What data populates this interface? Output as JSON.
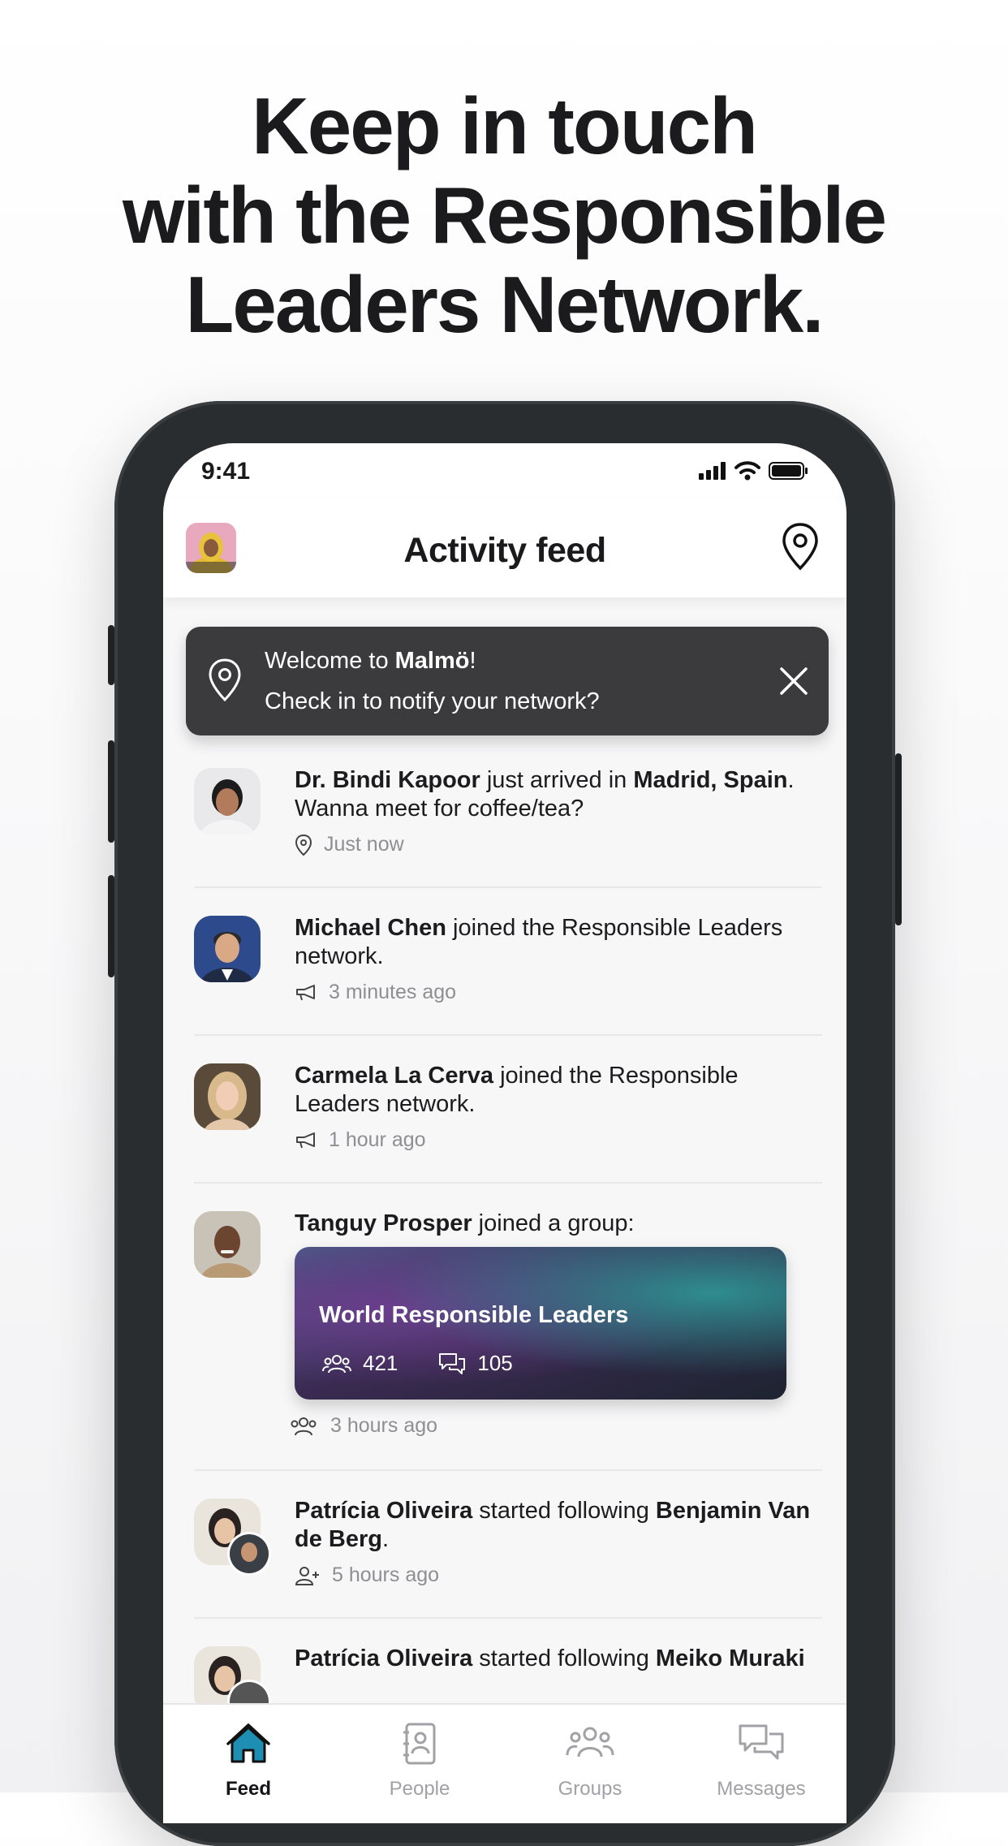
{
  "headline": {
    "line1": "Keep in touch",
    "line2": "with the Responsible",
    "line3": "Leaders Network."
  },
  "status_bar": {
    "time": "9:41"
  },
  "app_bar": {
    "title": "Activity feed"
  },
  "banner": {
    "welcome_prefix": "Welcome to ",
    "city": "Malmö",
    "welcome_suffix": "!",
    "question": "Check in to notify your network?"
  },
  "feed": {
    "items": [
      {
        "name": "Dr. Bindi Kapoor",
        "text1": " just arrived in ",
        "place": "Madrid, Spain",
        "text2": ". Wanna meet for coffee/tea?",
        "time": "Just now",
        "icon": "location-pin-icon"
      },
      {
        "name": "Michael Chen",
        "text1": " joined the Responsible Leaders network.",
        "time": "3 minutes ago",
        "icon": "megaphone-icon"
      },
      {
        "name": "Carmela La Cerva",
        "text1": " joined the Responsible Leaders network.",
        "time": "1 hour ago",
        "icon": "megaphone-icon"
      },
      {
        "name": "Tanguy Prosper",
        "text1": " joined a group:",
        "time": "3 hours ago",
        "icon": "group-icon",
        "group": {
          "name": "World Responsible Leaders",
          "members": "421",
          "posts": "105"
        }
      },
      {
        "name": "Patrícia Oliveira",
        "text1": " started following ",
        "target": "Benjamin Van de Berg",
        "text2": ".",
        "time": "5 hours ago",
        "icon": "follow-icon"
      },
      {
        "name": "Patrícia Oliveira",
        "text1": " started following ",
        "target": "Meiko Muraki"
      }
    ]
  },
  "tabbar": {
    "tabs": [
      {
        "label": "Feed",
        "icon": "home-icon",
        "active": true
      },
      {
        "label": "People",
        "icon": "contacts-icon",
        "active": false
      },
      {
        "label": "Groups",
        "icon": "groups-icon",
        "active": false
      },
      {
        "label": "Messages",
        "icon": "chat-bubbles-icon",
        "active": false
      }
    ]
  },
  "colors": {
    "accent": "#1e8fb3",
    "banner": "#3b3b3d",
    "meta": "#8e8e93"
  }
}
